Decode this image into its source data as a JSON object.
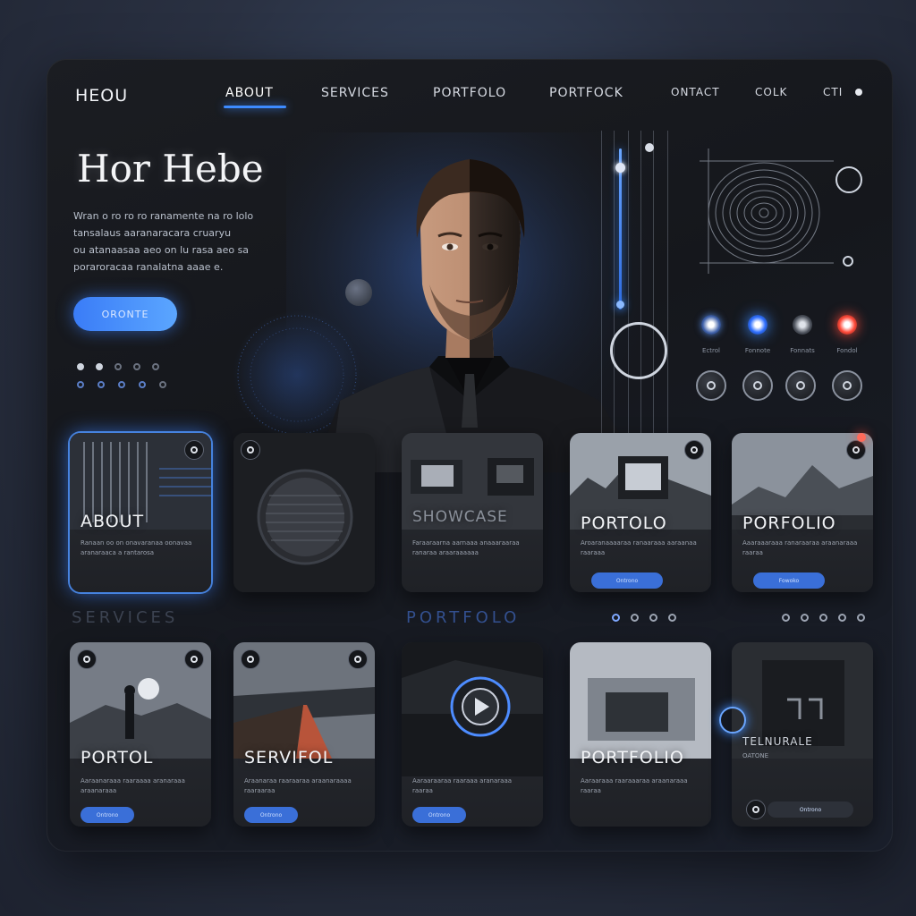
{
  "nav": {
    "brand": "HEOU",
    "links": [
      "ABOUT",
      "SERVICES",
      "PORTFOLO",
      "PORTFOCK",
      "ONTACT",
      "COLK",
      "CTI"
    ]
  },
  "hero": {
    "title": "Hor Hebe",
    "lines": [
      "Wran o ro ro ro ranamente na ro lolo",
      "tansalaus aaranaracara cruaryu",
      "ou atanaasaa aeo on lu rasa aeo sa",
      "poraroracaa ranalatna aaae e."
    ],
    "button": "ORONTE"
  },
  "controls": {
    "labels": [
      "Ectrol",
      "Fonnote",
      "Fonnats",
      "Fondol"
    ]
  },
  "cards_top": [
    {
      "title": "ABOUT",
      "text": "Ranaan oo on onavaranaa oonavaa aranaraaca a rantarosa",
      "button": ""
    },
    {
      "title": "",
      "text": "",
      "button": ""
    },
    {
      "title": "SHOWCASE",
      "text": "Faraaraarna aarnaaa anaaaraaraa ranaraa araaraaaaaa",
      "button": ""
    },
    {
      "title": "PORTOLO",
      "text": "Aroaranaaaaraa ranaaraaa aaraanaa raaraaa",
      "button": "Ontrono"
    },
    {
      "title": "PORFOLIO",
      "text": "Aaaraaaraaa ranaraaraa araanaraaa raaraa",
      "button": "Fowoko"
    }
  ],
  "sections": {
    "left": "SERVICES",
    "middle": "PORTFOLO"
  },
  "cards_bottom": [
    {
      "title": "PORTOL",
      "text": "Aaraanaraaa raaraaaa aranaraaa araanaraaa",
      "button": "Ontrono"
    },
    {
      "title": "SERVIFOL",
      "text": "Araanaraa raaraaraa araanaraaaa raaraaraa",
      "button": "Ontrono"
    },
    {
      "title": "",
      "text": "Aaraaraaraa raaraaa aranaraaa raaraa",
      "button": "Ontrono"
    },
    {
      "title": "PORTFOLIO",
      "text": "Aaraaraaa raaraaaraa araanaraaa raaraa",
      "button": ""
    },
    {
      "title": "TELNURALE",
      "text": "OATONE",
      "button": "Ontrono"
    }
  ],
  "colors": {
    "accent": "#3d8bff",
    "panel": "#17191e",
    "alert": "#ff4a3a"
  }
}
